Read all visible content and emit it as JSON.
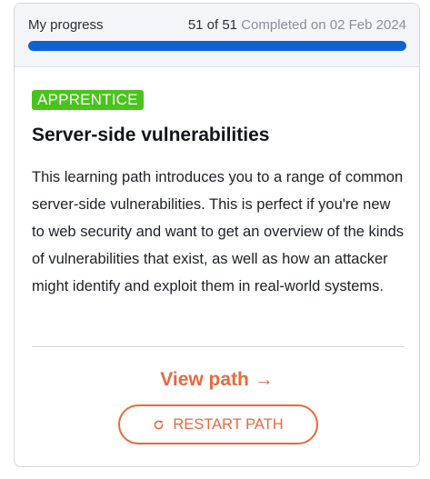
{
  "progress": {
    "label": "My progress",
    "count": "51 of 51",
    "completed": "Completed on 02 Feb 2024",
    "fraction": 1.0,
    "bar_color": "#0a63d1"
  },
  "course": {
    "badge": "APPRENTICE",
    "badge_color": "#49c41c",
    "title": "Server-side vulnerabilities",
    "description": "This learning path introduces you to a range of common server-side vulnerabilities. This is perfect if you're new to web security and want to get an overview of the kinds of vulnerabilities that exist, as well as how an attacker might identify and exploit them in real-world systems."
  },
  "actions": {
    "view_path": "View path →",
    "restart": "RESTART PATH",
    "restart_icon": "refresh-icon",
    "accent_color": "#e8693e"
  }
}
